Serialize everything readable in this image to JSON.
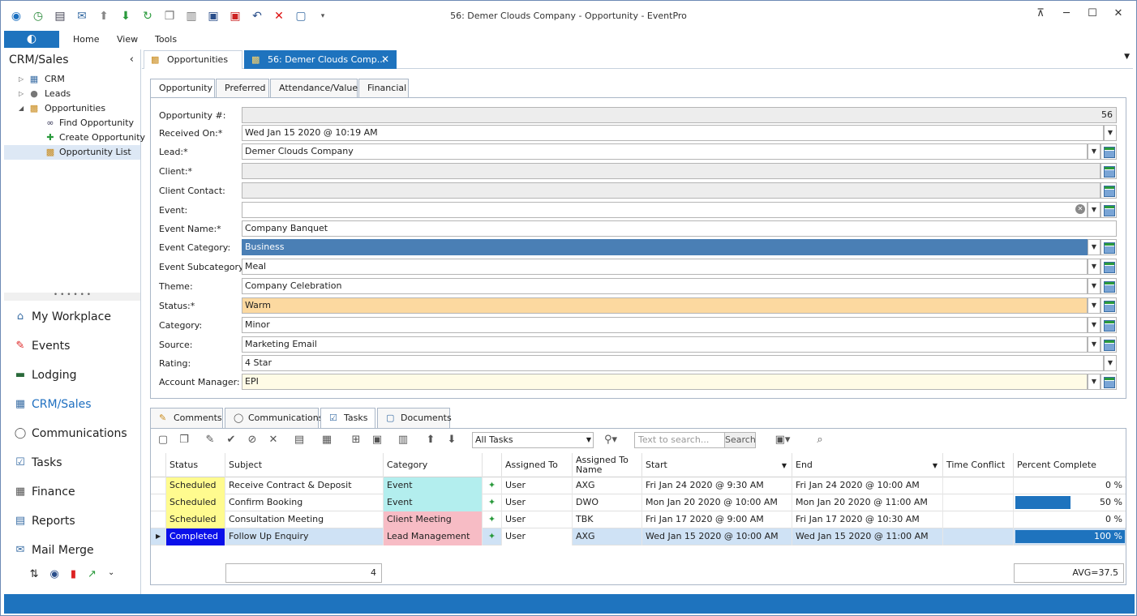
{
  "window": {
    "title": "56: Demer Clouds Company - Opportunity - EventPro"
  },
  "quick_access": [
    "back-icon",
    "clock-icon",
    "document-icon",
    "mail-icon",
    "up-icon",
    "down-icon",
    "refresh-icon",
    "copy-icon",
    "clipboard-icon",
    "save-icon",
    "save-close-icon",
    "undo-icon",
    "delete-icon",
    "new-icon",
    "customize-icon"
  ],
  "menu": {
    "items": [
      "Home",
      "View",
      "Tools"
    ]
  },
  "left": {
    "header": "CRM/Sales",
    "tree": [
      {
        "label": "CRM",
        "level": 0,
        "expander": "▷"
      },
      {
        "label": "Leads",
        "level": 0,
        "expander": "▷"
      },
      {
        "label": "Opportunities",
        "level": 0,
        "expander": "◢"
      },
      {
        "label": "Find Opportunity",
        "level": 1
      },
      {
        "label": "Create Opportunity",
        "level": 1
      },
      {
        "label": "Opportunity List",
        "level": 1,
        "selected": true
      }
    ],
    "splitter": "• • • • • •",
    "nav": [
      "My Workplace",
      "Events",
      "Lodging",
      "CRM/Sales",
      "Communications",
      "Tasks",
      "Finance",
      "Reports",
      "Mail Merge"
    ],
    "nav_active": "CRM/Sales"
  },
  "doc_tabs": [
    {
      "label": "Opportunities"
    },
    {
      "label": "56: Demer Clouds Comp...",
      "active": true
    }
  ],
  "form_tabs": [
    "Opportunity",
    "Preferred",
    "Attendance/Value",
    "Financial"
  ],
  "form": {
    "opportunity_no": {
      "label": "Opportunity #:",
      "value": "56"
    },
    "received_on": {
      "label": "Received On:*",
      "value": "Wed Jan 15 2020 @ 10:19 AM"
    },
    "lead": {
      "label": "Lead:*",
      "value": "Demer Clouds Company"
    },
    "client": {
      "label": "Client:*",
      "value": ""
    },
    "client_contact": {
      "label": "Client Contact:",
      "value": ""
    },
    "event": {
      "label": "Event:",
      "value": ""
    },
    "event_name": {
      "label": "Event Name:*",
      "value": "Company Banquet"
    },
    "event_category": {
      "label": "Event Category:",
      "value": "Business"
    },
    "event_subcategory": {
      "label": "Event Subcategory:",
      "value": "Meal"
    },
    "theme": {
      "label": "Theme:",
      "value": "Company Celebration"
    },
    "status": {
      "label": "Status:*",
      "value": "Warm"
    },
    "category": {
      "label": "Category:",
      "value": "Minor"
    },
    "source": {
      "label": "Source:",
      "value": "Marketing Email"
    },
    "rating": {
      "label": "Rating:",
      "value": "4 Star"
    },
    "account_manager": {
      "label": "Account Manager:",
      "value": "EPI"
    }
  },
  "bottom_tabs": [
    "Comments",
    "Communications",
    "Tasks",
    "Documents"
  ],
  "task_toolbar": {
    "filter": "All Tasks",
    "search_placeholder": "Text to search...",
    "search_button": "Search"
  },
  "grid": {
    "columns": [
      "Status",
      "Subject",
      "Category",
      "",
      "Assigned To",
      "Assigned To Name",
      "Start",
      "End",
      "Time Conflict",
      "Percent Complete"
    ],
    "rows": [
      {
        "status": "Scheduled",
        "subject": "Receive Contract & Deposit",
        "category": "Event",
        "flag": "✦",
        "assigned_to": "User",
        "assigned_name": "AXG",
        "start": "Fri Jan 24 2020 @ 9:30 AM",
        "end": "Fri Jan 24 2020 @ 10:00 AM",
        "conflict": "",
        "percent": "0 %",
        "percent_value": 0
      },
      {
        "status": "Scheduled",
        "subject": "Confirm Booking",
        "category": "Event",
        "flag": "✦",
        "assigned_to": "User",
        "assigned_name": "DWO",
        "start": "Mon Jan 20 2020 @ 10:00 AM",
        "end": "Mon Jan 20 2020 @ 11:00 AM",
        "conflict": "",
        "percent": "50 %",
        "percent_value": 50
      },
      {
        "status": "Scheduled",
        "subject": "Consultation Meeting",
        "category": "Client Meeting",
        "flag": "✦",
        "assigned_to": "User",
        "assigned_name": "TBK",
        "start": "Fri Jan 17 2020 @ 9:00 AM",
        "end": "Fri Jan 17 2020 @ 10:30 AM",
        "conflict": "",
        "percent": "0 %",
        "percent_value": 0
      },
      {
        "status": "Completed",
        "subject": "Follow Up Enquiry",
        "category": "Lead Management",
        "flag": "✦",
        "assigned_to": "User",
        "assigned_name": "AXG",
        "start": "Wed Jan 15 2020 @ 10:00 AM",
        "end": "Wed Jan 15 2020 @ 11:00 AM",
        "conflict": "",
        "percent": "100 %",
        "percent_value": 100
      }
    ],
    "footer_count": "4",
    "footer_avg": "AVG=37.5"
  },
  "colors": {
    "accent": "#1e73be",
    "scheduled": "#fffb8f",
    "completed": "#0a10ea",
    "event_cat": "#b3eeee",
    "meeting_cat": "#f7bcc5",
    "warm": "#fcd9a0",
    "account_manager": "#fffbe6"
  }
}
